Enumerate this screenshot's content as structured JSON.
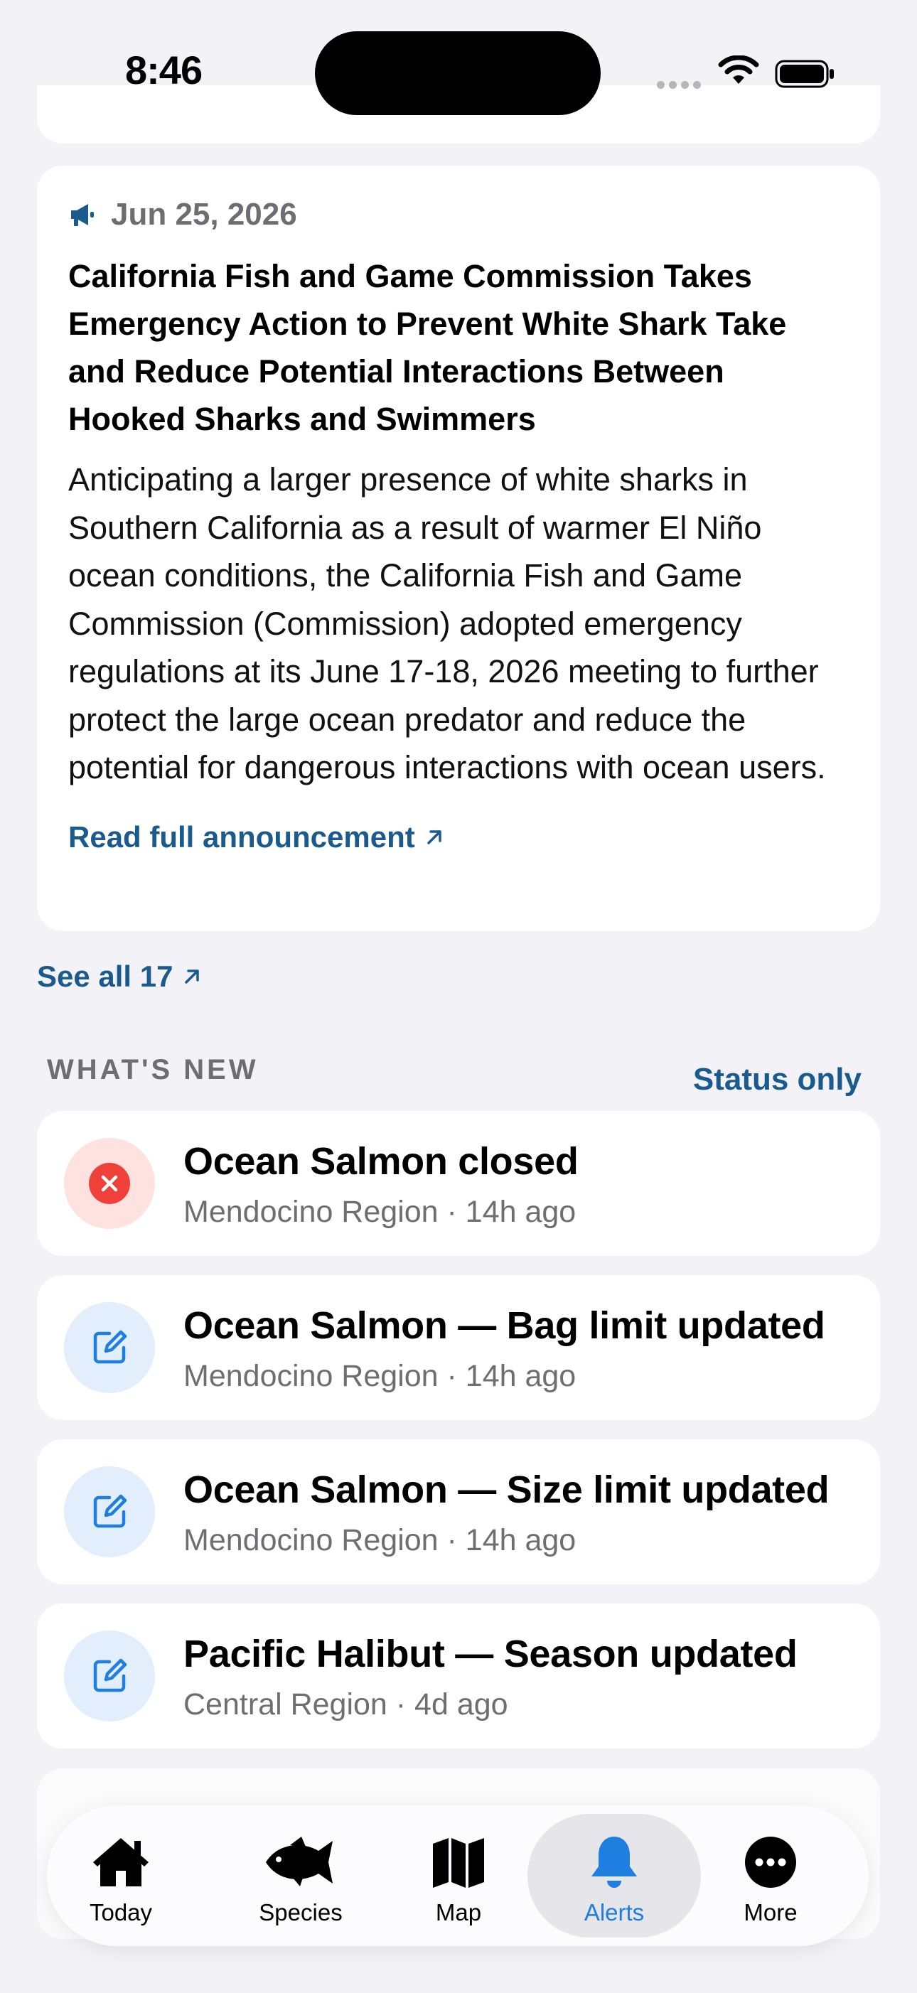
{
  "status_bar": {
    "time": "8:46"
  },
  "announcement": {
    "date": "Jun 25, 2026",
    "title": "California Fish and Game Commission Takes Emergency Action to Prevent White Shark Take and Reduce Potential Interactions Between Hooked Sharks and Swimmers",
    "body": "Anticipating a larger presence of white sharks in Southern California as a result of warmer El Niño ocean conditions, the California Fish and Game Commission (Commission) adopted emergency regulations at its June 17-18, 2026 meeting to further protect the large ocean predator and reduce the potential for dangerous interactions with ocean users.",
    "link_label": "Read full announcement",
    "icon": "megaphone-icon"
  },
  "see_all": {
    "label": "See all 17"
  },
  "whats_new": {
    "heading": "WHAT'S NEW",
    "filter_label": "Status only",
    "items": [
      {
        "title": "Ocean Salmon closed",
        "meta": "Mendocino Region · 14h ago",
        "icon": "close-circle-icon",
        "kind": "closed"
      },
      {
        "title": "Ocean Salmon — Bag limit updated",
        "meta": "Mendocino Region · 14h ago",
        "icon": "edit-icon",
        "kind": "edit"
      },
      {
        "title": "Ocean Salmon — Size limit updated",
        "meta": "Mendocino Region · 14h ago",
        "icon": "edit-icon",
        "kind": "edit"
      },
      {
        "title": "Pacific Halibut — Season updated",
        "meta": "Central Region · 4d ago",
        "icon": "edit-icon",
        "kind": "edit"
      }
    ]
  },
  "tabbar": {
    "active": "Alerts",
    "tabs": [
      {
        "label": "Today",
        "icon": "house-icon"
      },
      {
        "label": "Species",
        "icon": "fish-icon"
      },
      {
        "label": "Map",
        "icon": "map-icon"
      },
      {
        "label": "Alerts",
        "icon": "bell-icon"
      },
      {
        "label": "More",
        "icon": "ellipsis-circle-icon"
      }
    ]
  },
  "colors": {
    "accent": "#1a5a8c",
    "tab_active": "#1e7fe0",
    "closed_red": "#f0403a",
    "edit_blue": "#1e7fe0",
    "background": "#f2f2f7"
  }
}
